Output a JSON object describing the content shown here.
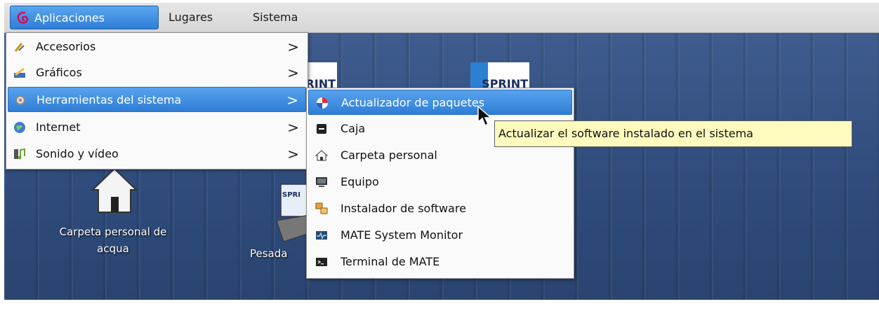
{
  "panel": {
    "applications": "Aplicaciones",
    "places": "Lugares",
    "system": "Sistema"
  },
  "desktop": {
    "home_label_line1": "Carpeta personal de",
    "home_label_line2": "acqua",
    "partial_label": "Pesada",
    "sprint_text": "SPRINT"
  },
  "main_menu": {
    "items": [
      {
        "label": "Accesorios",
        "icon": "accessories-icon"
      },
      {
        "label": "Gráficos",
        "icon": "graphics-icon"
      },
      {
        "label": "Herramientas del sistema",
        "icon": "system-tools-icon",
        "selected": true
      },
      {
        "label": "Internet",
        "icon": "internet-icon"
      },
      {
        "label": "Sonido y vídeo",
        "icon": "sound-video-icon"
      }
    ],
    "arrow": ">"
  },
  "sub_menu": {
    "items": [
      {
        "label": "Actualizador de paquetes",
        "icon": "package-updater-icon",
        "selected": true
      },
      {
        "label": "Caja",
        "icon": "box-icon"
      },
      {
        "label": "Carpeta personal",
        "icon": "home-folder-icon"
      },
      {
        "label": "Equipo",
        "icon": "computer-icon"
      },
      {
        "label": "Instalador de software",
        "icon": "software-installer-icon"
      },
      {
        "label": "MATE System Monitor",
        "icon": "system-monitor-icon"
      },
      {
        "label": "Terminal de MATE",
        "icon": "terminal-icon"
      }
    ]
  },
  "tooltip": "Actualizar el software instalado en el sistema",
  "colors": {
    "selection": "#2f7ed6",
    "desktop": "#2f4c7c",
    "tooltip_bg": "#fffbbe"
  }
}
